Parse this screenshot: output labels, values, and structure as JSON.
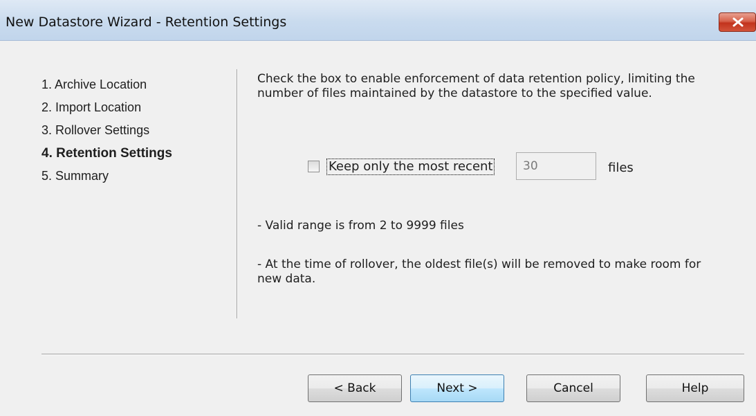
{
  "window": {
    "title": "New Datastore Wizard - Retention Settings",
    "close_icon": "close-x-icon"
  },
  "steps": [
    {
      "label": "1. Archive Location",
      "current": false
    },
    {
      "label": "2. Import Location",
      "current": false
    },
    {
      "label": "3. Rollover Settings",
      "current": false
    },
    {
      "label": "4. Retention Settings",
      "current": true
    },
    {
      "label": "5. Summary",
      "current": false
    }
  ],
  "content": {
    "description": "Check the box to enable enforcement of data retention policy, limiting the number of files maintained by the datastore to the specified value.",
    "keep_checkbox": {
      "label": "Keep only the most recent",
      "checked": false
    },
    "file_count": {
      "value": "30",
      "unit_label": "files"
    },
    "note_range": "- Valid range is from 2 to 9999 files",
    "note_rollover": "- At the time of rollover, the oldest file(s) will be removed to make room for new data."
  },
  "buttons": {
    "back": "< Back",
    "next": "Next >",
    "cancel": "Cancel",
    "help": "Help"
  },
  "colors": {
    "titlebar": "#c9dbee",
    "close_button": "#c2331d",
    "default_button": "#bee6fd"
  }
}
